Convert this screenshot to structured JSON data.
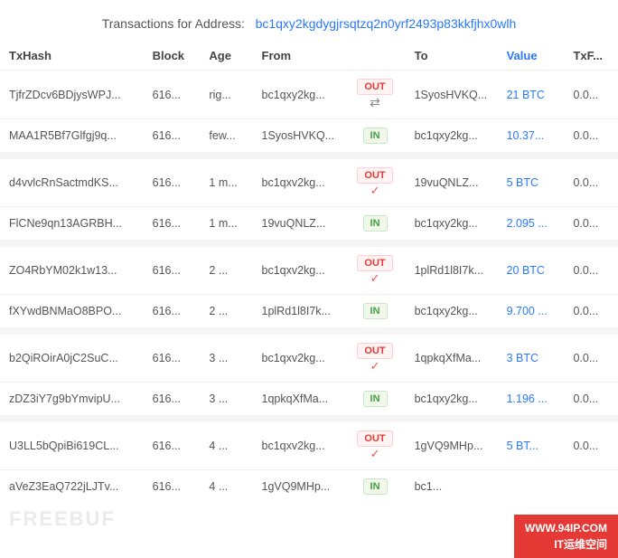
{
  "header": {
    "label": "Transactions for Address:",
    "address": "bc1qxy2kgdygjrsqtzq2n0yrf2493p83kkfjhx0wlh",
    "address_link": "#"
  },
  "columns": {
    "txhash": "TxHash",
    "block": "Block",
    "age": "Age",
    "from": "From",
    "direction": "",
    "to": "To",
    "value": "Value",
    "txfee": "TxF..."
  },
  "groups": [
    {
      "rows": [
        {
          "txhash": "TjfrZDcv6BDjysWPJ...",
          "block": "616...",
          "age": "rig...",
          "from": "bc1qxy2kg...",
          "dir": "OUT",
          "to": "1SyosHVKQ...",
          "value": "21 BTC",
          "txfee": "0.0...",
          "icon": "arrow"
        },
        {
          "txhash": "MAA1R5Bf7Glfgj9q...",
          "block": "616...",
          "age": "few...",
          "from": "1SyosHVKQ...",
          "dir": "IN",
          "to": "bc1qxy2kg...",
          "value": "10.37...",
          "txfee": "0.0...",
          "icon": "none"
        }
      ]
    },
    {
      "rows": [
        {
          "txhash": "d4vvlcRnSactmdKS...",
          "block": "616...",
          "age": "1 m...",
          "from": "bc1qxv2kg...",
          "dir": "OUT",
          "to": "19vuQNLZ...",
          "value": "5 BTC",
          "txfee": "0.0...",
          "icon": "check"
        },
        {
          "txhash": "FlCNe9qn13AGRBH...",
          "block": "616...",
          "age": "1 m...",
          "from": "19vuQNLZ...",
          "dir": "IN",
          "to": "bc1qxy2kg...",
          "value": "2.095 ...",
          "txfee": "0.0...",
          "icon": "none"
        }
      ]
    },
    {
      "rows": [
        {
          "txhash": "ZO4RbYM02k1w13...",
          "block": "616...",
          "age": "2 ...",
          "from": "bc1qxv2kg...",
          "dir": "OUT",
          "to": "1plRd1l8I7k...",
          "value": "20 BTC",
          "txfee": "0.0...",
          "icon": "check"
        },
        {
          "txhash": "fXYwdBNMaO8BPO...",
          "block": "616...",
          "age": "2 ...",
          "from": "1plRd1l8I7k...",
          "dir": "IN",
          "to": "bc1qxy2kg...",
          "value": "9.700 ...",
          "txfee": "0.0...",
          "icon": "none"
        }
      ]
    },
    {
      "rows": [
        {
          "txhash": "b2QiROirA0jC2SuC...",
          "block": "616...",
          "age": "3 ...",
          "from": "bc1qxv2kg...",
          "dir": "OUT",
          "to": "1qpkqXfMa...",
          "value": "3 BTC",
          "txfee": "0.0...",
          "icon": "check"
        },
        {
          "txhash": "zDZ3iY7g9bYmvipU...",
          "block": "616...",
          "age": "3 ...",
          "from": "1qpkqXfMa...",
          "dir": "IN",
          "to": "bc1qxy2kg...",
          "value": "1.196 ...",
          "txfee": "0.0...",
          "icon": "none"
        }
      ]
    },
    {
      "rows": [
        {
          "txhash": "U3LL5bQpiBi619CL...",
          "block": "616...",
          "age": "4 ...",
          "from": "bc1qxv2kg...",
          "dir": "OUT",
          "to": "1gVQ9MHp...",
          "value": "5 BT...",
          "txfee": "0.0...",
          "icon": "check"
        },
        {
          "txhash": "aVeZ3EaQ722jLJTv...",
          "block": "616...",
          "age": "4 ...",
          "from": "1gVQ9MHp...",
          "dir": "IN",
          "to": "bc1...",
          "value": "",
          "txfee": "",
          "icon": "none"
        }
      ]
    }
  ],
  "watermark": {
    "line1": "WWW.94IP.COM",
    "line2": "IT运维空间"
  },
  "logo_text": "FREEBUF"
}
